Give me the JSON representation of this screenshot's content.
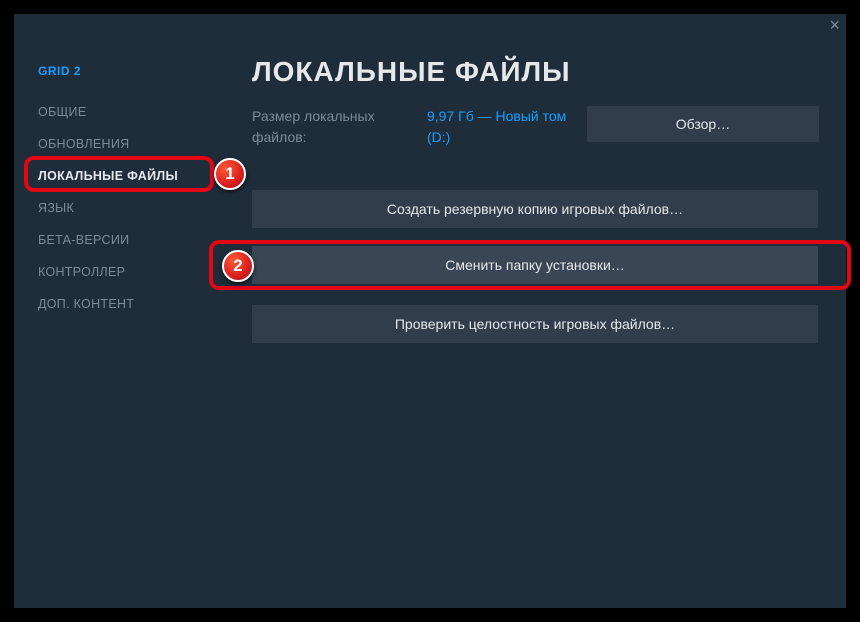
{
  "game_title": "GRID 2",
  "close_label": "×",
  "sidebar": {
    "items": [
      {
        "label": "ОБЩИЕ"
      },
      {
        "label": "ОБНОВЛЕНИЯ"
      },
      {
        "label": "ЛОКАЛЬНЫЕ ФАЙЛЫ"
      },
      {
        "label": "ЯЗЫК"
      },
      {
        "label": "БЕТА-ВЕРСИИ"
      },
      {
        "label": "КОНТРОЛЛЕР"
      },
      {
        "label": "ДОП. КОНТЕНТ"
      }
    ]
  },
  "page": {
    "title": "ЛОКАЛЬНЫЕ ФАЙЛЫ",
    "size_label": "Размер локальных файлов:",
    "size_value": "9,97 Гб — Новый том (D:)",
    "browse_label": "Обзор…",
    "buttons": {
      "backup": "Создать резервную копию игровых файлов…",
      "move": "Сменить папку установки…",
      "verify": "Проверить целостность игровых файлов…"
    }
  },
  "annotations": {
    "badge1": "1",
    "badge2": "2"
  }
}
